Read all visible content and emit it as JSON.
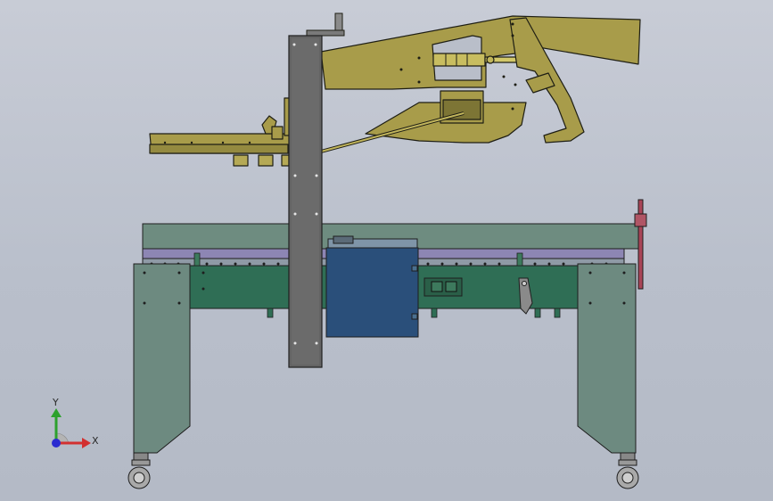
{
  "triad": {
    "y_label": "Y",
    "x_label": "X"
  },
  "colors": {
    "background": "#bfc4ce",
    "frame_green": "#2f6e55",
    "leg_gray": "#6d8a80",
    "top_plate": "#6e8c80",
    "roller_strip": "#8d86b4",
    "column": "#6b6b6b",
    "box_blue": "#2a4f7a",
    "arm_olive": "#a79c48",
    "handle_red": "#a94457",
    "axis_y": "#2da12d",
    "axis_x": "#d23030",
    "axis_z": "#2b2bd0"
  }
}
